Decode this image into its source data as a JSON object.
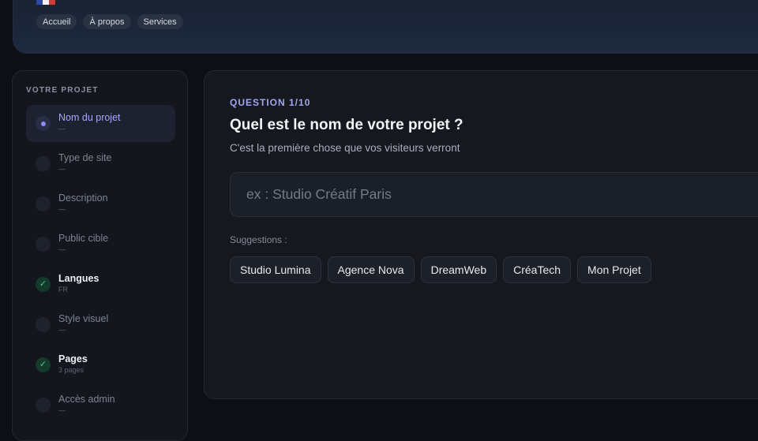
{
  "header": {
    "flag_icon": "france-flag-icon",
    "nav": [
      "Accueil",
      "À propos",
      "Services"
    ]
  },
  "sidebar": {
    "title": "VOTRE PROJET",
    "steps": [
      {
        "label": "Nom du projet",
        "sub": "—",
        "state": "active"
      },
      {
        "label": "Type de site",
        "sub": "—",
        "state": "pending"
      },
      {
        "label": "Description",
        "sub": "—",
        "state": "pending"
      },
      {
        "label": "Public cible",
        "sub": "—",
        "state": "pending"
      },
      {
        "label": "Langues",
        "sub": "FR",
        "state": "done"
      },
      {
        "label": "Style visuel",
        "sub": "—",
        "state": "pending"
      },
      {
        "label": "Pages",
        "sub": "3 pages",
        "state": "done"
      },
      {
        "label": "Accès admin",
        "sub": "—",
        "state": "pending"
      }
    ]
  },
  "question": {
    "kicker": "QUESTION 1/10",
    "title": "Quel est le nom de votre projet ?",
    "description": "C'est la première chose que vos visiteurs verront",
    "input_value": "",
    "input_placeholder": "ex : Studio Créatif Paris",
    "suggestions_label": "Suggestions :",
    "suggestions": [
      "Studio Lumina",
      "Agence Nova",
      "DreamWeb",
      "CréaTech",
      "Mon Projet"
    ]
  },
  "colors": {
    "accent": "#a3a6f2",
    "done": "#34d399",
    "background": "#0d0f14"
  }
}
